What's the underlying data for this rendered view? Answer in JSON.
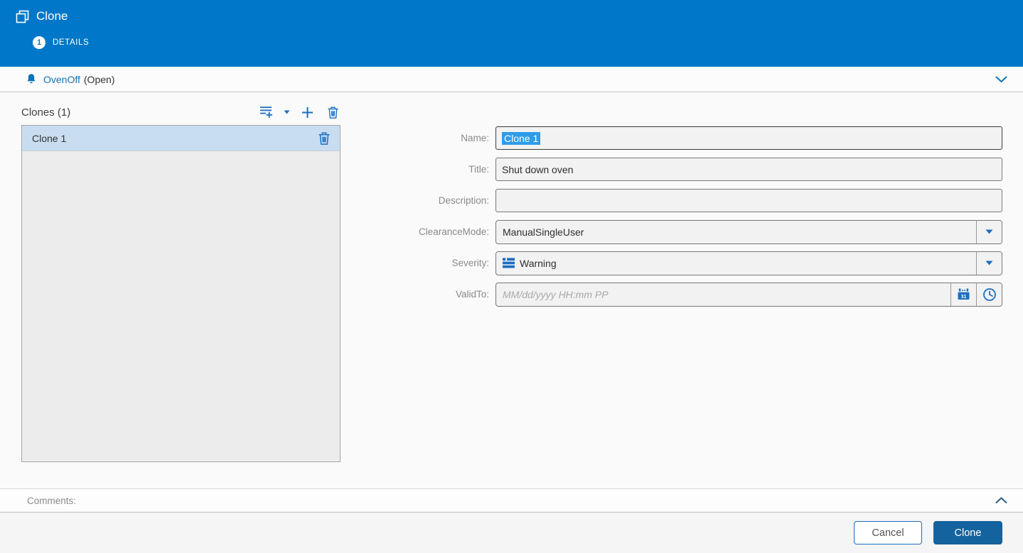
{
  "header": {
    "title": "Clone",
    "step_number": "1",
    "step_label": "DETAILS"
  },
  "alarm_bar": {
    "name": "OvenOff",
    "state": "(Open)"
  },
  "clones_panel": {
    "title": "Clones (1)",
    "items": [
      {
        "label": "Clone 1",
        "selected": true
      }
    ]
  },
  "form": {
    "name": {
      "label": "Name:",
      "value": "Clone 1",
      "text_selected": true
    },
    "title": {
      "label": "Title:",
      "value": "Shut down oven"
    },
    "description": {
      "label": "Description:",
      "value": ""
    },
    "clearance_mode": {
      "label": "ClearanceMode:",
      "value": "ManualSingleUser"
    },
    "severity": {
      "label": "Severity:",
      "value": "Warning"
    },
    "valid_to": {
      "label": "ValidTo:",
      "value": "",
      "placeholder": "MM/dd/yyyy HH:mm PP"
    }
  },
  "comments": {
    "label": "Comments:"
  },
  "footer": {
    "cancel_label": "Cancel",
    "clone_label": "Clone"
  },
  "colors": {
    "header_blue": "#0077c8",
    "accent_blue": "#1b6ec2",
    "link_blue": "#1072b8",
    "primary_button_blue": "#15639e",
    "text_selection_blue": "#2e9ce9",
    "selected_row_bg": "#c9ddf0",
    "field_bg": "#f2f2f2"
  },
  "icons": {
    "clone_icon": "copy-overlapping-squares",
    "bell_icon": "bell",
    "chevron_down_icon": "chevron-down",
    "chevron_up_icon": "chevron-up",
    "add_multiple_icon": "add-multiple-lines-plus",
    "dropdown_caret_icon": "caret-down",
    "add_icon": "plus",
    "delete_icon": "trash",
    "severity_icon": "severity-list-bars",
    "calendar_icon": "calendar",
    "calendar_day_label": "31",
    "clock_icon": "clock"
  }
}
